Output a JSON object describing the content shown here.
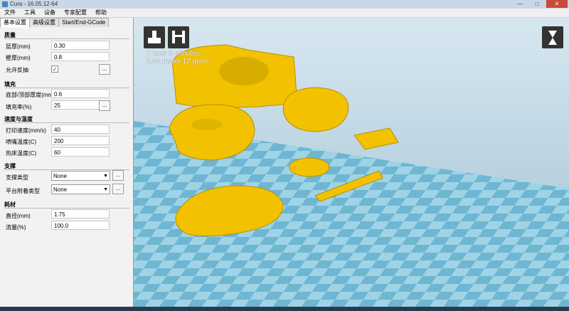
{
  "window": {
    "title": "Cura - 16.05.12-64"
  },
  "window_controls": {
    "minimize": "—",
    "maximize": "□",
    "close": "✕"
  },
  "menu": [
    "文件",
    "工具",
    "设备",
    "专家配置",
    "帮助"
  ],
  "tabs": [
    "基本设置",
    "高级设置",
    "Start/End-GCode"
  ],
  "sections": {
    "quality": "质量",
    "fill": "填充",
    "speed": "速度与温度",
    "support": "支撑",
    "filament": "耗材"
  },
  "fields": {
    "layer_height": {
      "label": "层厚(mm)",
      "value": "0.30"
    },
    "shell_thickness": {
      "label": "壁厚(mm)",
      "value": "0.8"
    },
    "retraction": {
      "label": "允许反抽",
      "checked": "✓"
    },
    "bottom_top_thickness": {
      "label": "底部/顶部厚度(mm)",
      "value": "0.6"
    },
    "fill_density": {
      "label": "填充率(%)",
      "value": "25"
    },
    "print_speed": {
      "label": "打印速度(mm/s)",
      "value": "40"
    },
    "nozzle_temp": {
      "label": "喷嘴温度(C)",
      "value": "200"
    },
    "bed_temp": {
      "label": "热床温度(C)",
      "value": "60"
    },
    "support_type": {
      "label": "支撑类型",
      "value": "None"
    },
    "adhesion_type": {
      "label": "平台附着类型",
      "value": "None"
    },
    "diameter": {
      "label": "直径(mm)",
      "value": "1.75"
    },
    "flow": {
      "label": "流量(%)",
      "value": "100.0"
    }
  },
  "more_button": "...",
  "print_info": {
    "time": "1 hour 3 minutes",
    "material": "3.94 meter 12 gram"
  },
  "icons": {
    "load": "load-model-icon",
    "save": "save-toolpath-icon",
    "view_mode": "view-mode-icon"
  },
  "colors": {
    "model": "#f2c200",
    "bed_light": "#9fd3e6",
    "bed_dark": "#6fb6d2",
    "panel": "#f2f2f2"
  }
}
